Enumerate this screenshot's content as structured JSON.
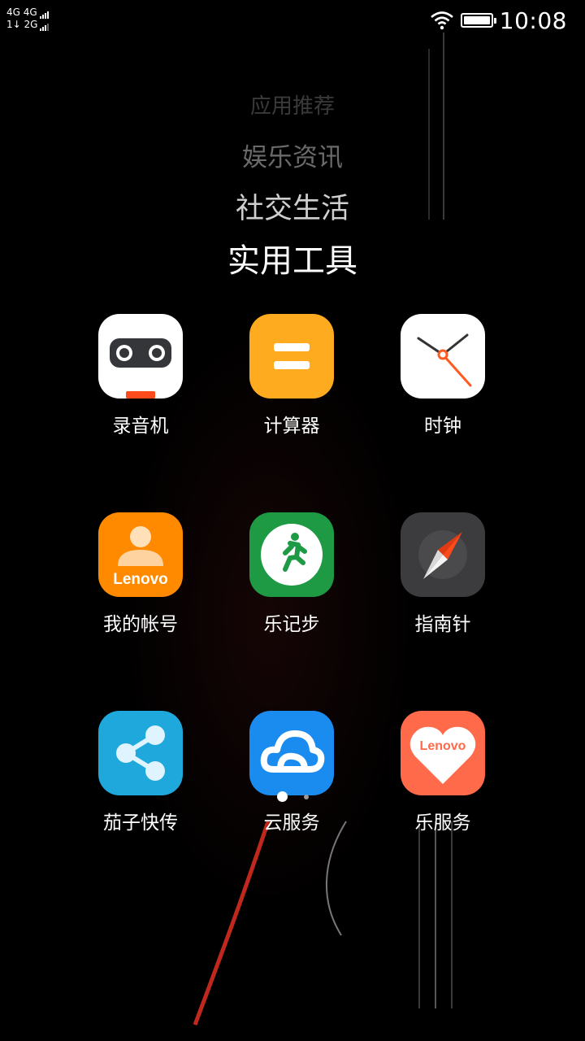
{
  "status_bar": {
    "signal_line1": "4G 4G",
    "signal_line2": "1↓ 2G",
    "time": "10:08"
  },
  "categories": [
    {
      "label": "应用推荐"
    },
    {
      "label": "娱乐资讯"
    },
    {
      "label": "社交生活"
    },
    {
      "label": "实用工具"
    }
  ],
  "apps": [
    {
      "label": "录音机",
      "icon": "recorder-icon",
      "color": "#ffffff"
    },
    {
      "label": "计算器",
      "icon": "calculator-icon",
      "color": "#ffab1f"
    },
    {
      "label": "时钟",
      "icon": "clock-icon",
      "color": "#ffffff"
    },
    {
      "label": "我的帐号",
      "icon": "lenovo-account-icon",
      "color": "#ff8a00",
      "icon_text": "Lenovo"
    },
    {
      "label": "乐记步",
      "icon": "step-counter-icon",
      "color": "#1e9a45"
    },
    {
      "label": "指南针",
      "icon": "compass-icon",
      "color": "#3c3c3e"
    },
    {
      "label": "茄子快传",
      "icon": "share-icon",
      "color": "#1ea8dc"
    },
    {
      "label": "云服务",
      "icon": "cloud-service-icon",
      "color": "#1a8cf0"
    },
    {
      "label": "乐服务",
      "icon": "lenovo-service-icon",
      "color": "#ff6a4a",
      "icon_text": "Lenovo"
    }
  ],
  "pagination": {
    "current": 1,
    "total": 2
  }
}
